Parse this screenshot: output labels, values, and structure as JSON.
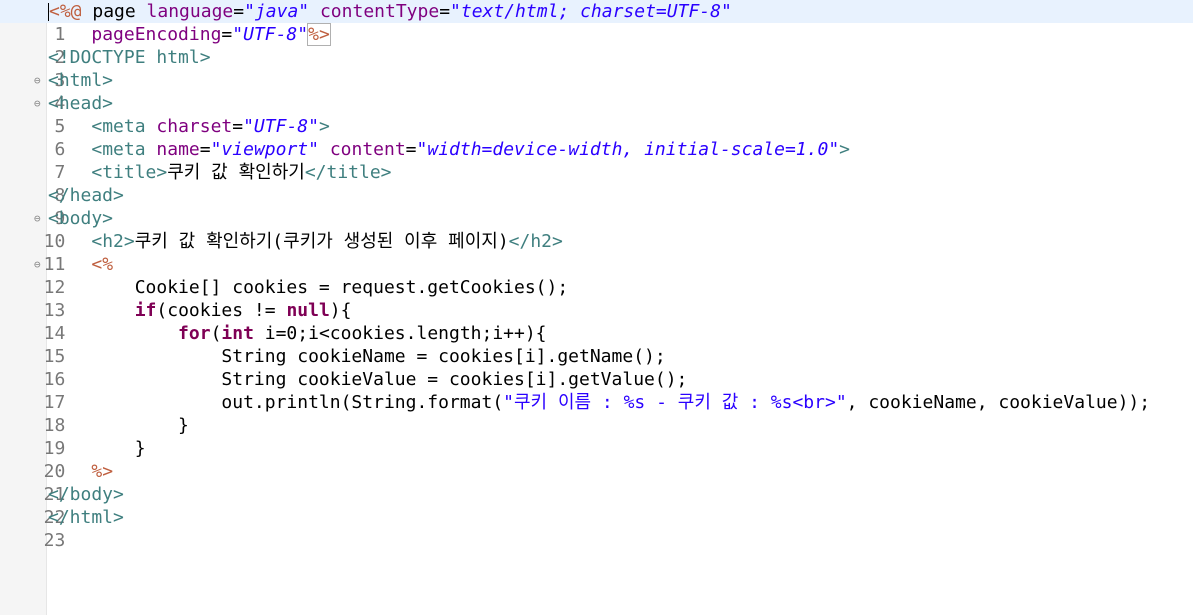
{
  "editor": {
    "line_numbers": [
      "1",
      "2",
      "3",
      "4",
      "5",
      "6",
      "7",
      "8",
      "9",
      "10",
      "11",
      "12",
      "13",
      "14",
      "15",
      "16",
      "17",
      "18",
      "19",
      "20",
      "21",
      "22",
      "23"
    ],
    "fold_markers": {
      "4": "⊖",
      "5": "⊖",
      "10": "⊖",
      "12": "⊖"
    },
    "tokens": {
      "l1": [
        "<%@",
        " page ",
        "language",
        "=",
        "\"java\"",
        " ",
        "contentType",
        "=",
        "\"text/html; charset=UTF-8\""
      ],
      "l2": [
        "    ",
        "pageEncoding",
        "=",
        "\"UTF-8\"",
        "%>"
      ],
      "l3": [
        "<!DOCTYPE html>"
      ],
      "l4": [
        "<html>"
      ],
      "l5": [
        "<head>"
      ],
      "l6": [
        "    ",
        "<meta",
        " ",
        "charset",
        "=",
        "\"UTF-8\"",
        ">"
      ],
      "l7": [
        "    ",
        "<meta",
        " ",
        "name",
        "=",
        "\"viewport\"",
        " ",
        "content",
        "=",
        "\"width=device-width, initial-scale=1.0\"",
        ">"
      ],
      "l8": [
        "    ",
        "<title>",
        "쿠키 값 확인하기",
        "</title>"
      ],
      "l9": [
        "</head>"
      ],
      "l10": [
        "<body>"
      ],
      "l11": [
        "    ",
        "<h2>",
        "쿠키 값 확인하기(쿠키가 생성된 이후 페이지)",
        "</h2>"
      ],
      "l12": [
        "    ",
        "<%"
      ],
      "l13": [
        "        Cookie[] cookies = request.getCookies();"
      ],
      "l14": [
        "        ",
        "if",
        "(cookies != ",
        "null",
        "){"
      ],
      "l15": [
        "            ",
        "for",
        "(",
        "int",
        " i=0;i<cookies.length;i++){"
      ],
      "l16": [
        "                String cookieName = cookies[i].getName();"
      ],
      "l17": [
        "                String cookieValue = cookies[i].getValue();"
      ],
      "l18": [
        "                out.println(String.format(",
        "\"쿠키 이름 : %s - 쿠키 값 : %s<br>\"",
        ", cookieName, cookieValue));"
      ],
      "l19": [
        "            }"
      ],
      "l20": [
        "        }"
      ],
      "l21": [
        "    ",
        "%>"
      ],
      "l22": [
        "</body>"
      ],
      "l23": [
        "</html>"
      ]
    }
  }
}
